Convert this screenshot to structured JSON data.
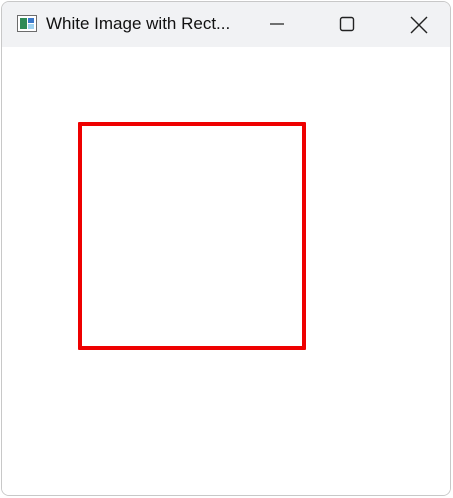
{
  "window": {
    "title": "White Image with Rect...",
    "app_icon": "image-viewer-icon",
    "controls": {
      "minimize_icon": "minimize-icon",
      "maximize_icon": "maximize-icon",
      "close_icon": "close-icon"
    }
  },
  "canvas": {
    "background": "#ffffff",
    "shape": {
      "type": "rectangle",
      "stroke_color": "#ee0000",
      "fill": "none"
    }
  },
  "colors": {
    "titlebar": "#f1f2f4",
    "title_text": "#111111",
    "accent": "#ee0000"
  }
}
